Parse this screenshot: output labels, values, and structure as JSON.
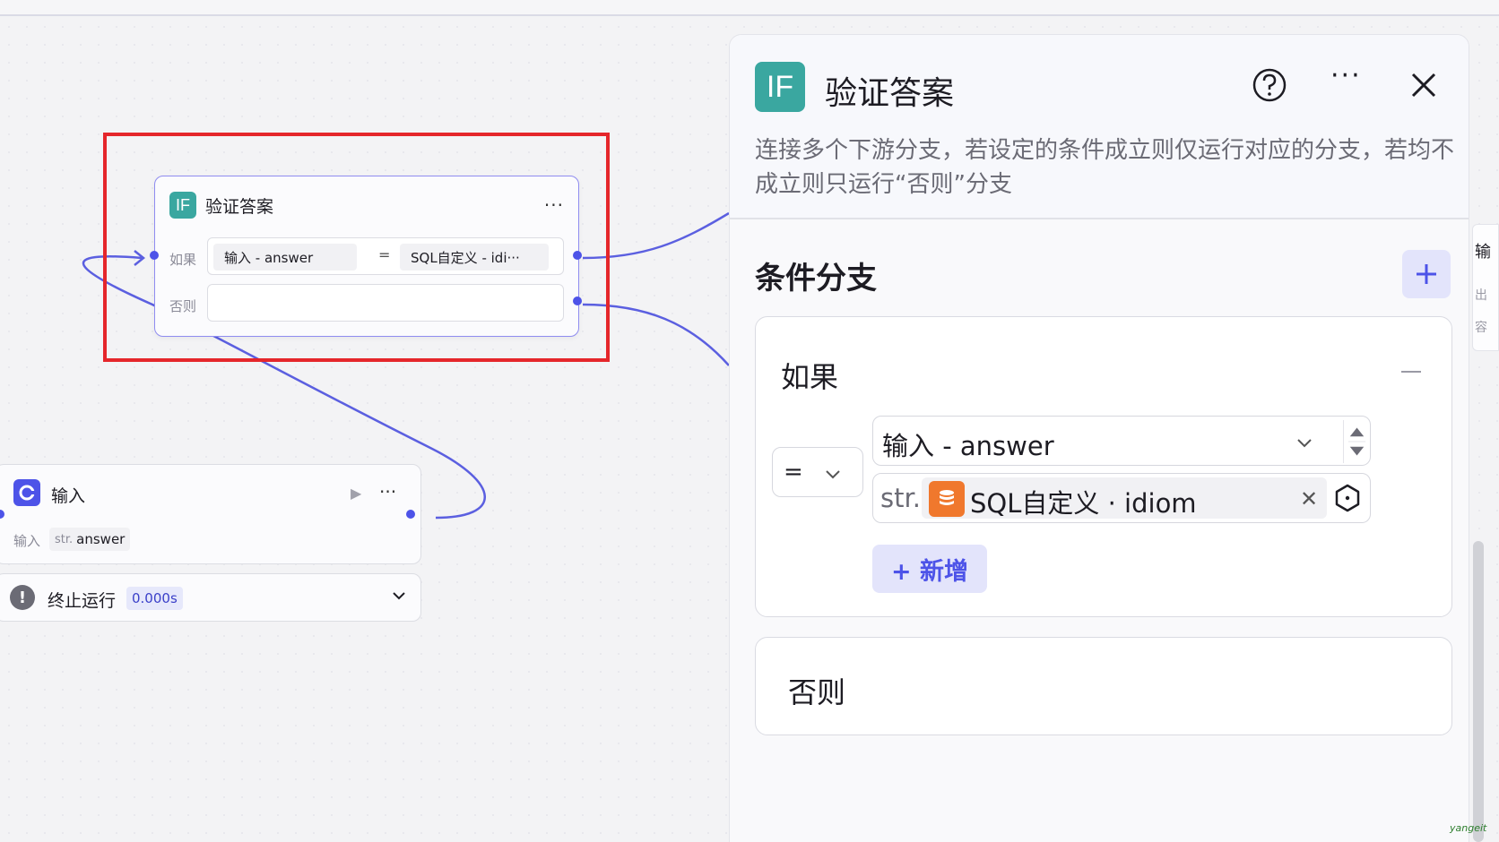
{
  "if_node": {
    "badge": "IF",
    "title": "验证答案",
    "more": "···",
    "if_label": "如果",
    "else_label": "否则",
    "left_operand": "输入  -  answer",
    "operator": "=",
    "right_operand": "SQL自定义  -  idi···"
  },
  "input_node": {
    "title": "输入",
    "more": "···",
    "param_label": "输入",
    "param_type": "str.",
    "param_name": "answer"
  },
  "status": {
    "text": "终止运行",
    "time": "0.000s"
  },
  "panel": {
    "badge": "IF",
    "title": "验证答案",
    "more": "···",
    "description": "连接多个下游分支，若设定的条件成立则仅运行对应的分支，若均不成立则只运行“否则”分支",
    "section_title": "条件分支",
    "if_card": {
      "title": "如果",
      "operator": "=",
      "left_value": "输入 - answer",
      "right_type": "str.",
      "right_value": "SQL自定义 · idiom",
      "add_label": "+ 新增"
    },
    "else_card": {
      "title": "否则"
    }
  },
  "side_panel": {
    "line1": "输",
    "line2": "出",
    "line3": "容"
  },
  "watermark": "yangeit",
  "colors": {
    "accent": "#4d53e8",
    "if_badge": "#3aa7a0",
    "highlight": "#e5262b",
    "db_icon": "#f0782d"
  }
}
